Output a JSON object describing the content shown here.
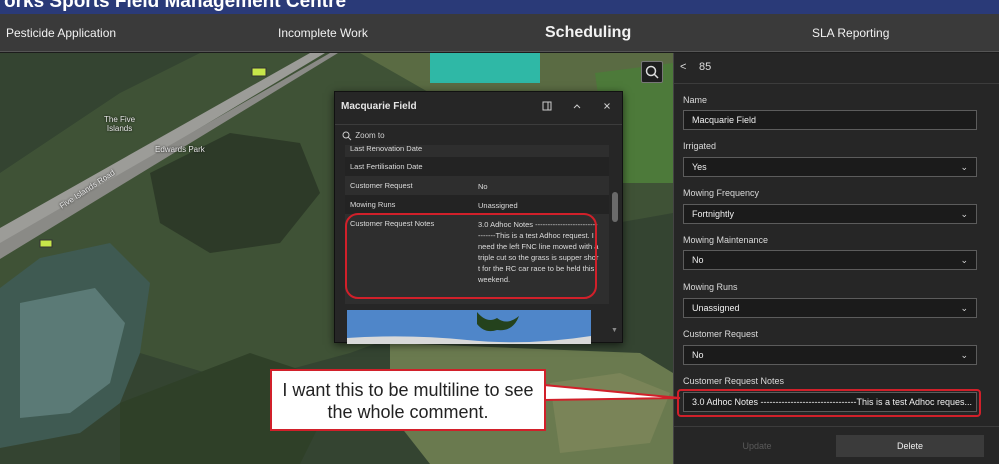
{
  "app": {
    "banner_title": "orks Sports Field Management Centre"
  },
  "nav": {
    "pesticide": "Pesticide Application",
    "incomplete": "Incomplete Work",
    "scheduling": "Scheduling",
    "sla": "SLA Reporting"
  },
  "map": {
    "labels": {
      "five_islands": "The Five\nIslands",
      "edwards_park": "Edwards Park",
      "road": "Five Islands Road"
    }
  },
  "popup": {
    "title": "Macquarie Field",
    "zoom_label": "Zoom to",
    "rows": [
      {
        "key": "Last Renovation Date",
        "value": ""
      },
      {
        "key": "Last Fertilisation Date",
        "value": ""
      },
      {
        "key": "Customer Request",
        "value": "No"
      },
      {
        "key": "Mowing Runs",
        "value": "Unassigned"
      },
      {
        "key": "Customer Request Notes",
        "value": "3.0 Adhoc Notes --------------------------------This is a test Adhoc request. I need the left FNC line mowed with a triple cut so the grass is supper short for the RC car race to be held this weekend."
      }
    ]
  },
  "panel": {
    "record_id": "85",
    "fields": [
      {
        "label": "Name",
        "value": "Macquarie Field",
        "type": "text"
      },
      {
        "label": "Irrigated",
        "value": "Yes",
        "type": "select"
      },
      {
        "label": "Mowing Frequency",
        "value": "Fortnightly",
        "type": "select"
      },
      {
        "label": "Mowing Maintenance",
        "value": "No",
        "type": "select"
      },
      {
        "label": "Mowing Runs",
        "value": "Unassigned",
        "type": "select"
      },
      {
        "label": "Customer Request",
        "value": "No",
        "type": "select"
      },
      {
        "label": "Customer Request Notes",
        "value": "3.0 Adhoc Notes --------------------------------This is a test Adhoc reques...",
        "type": "text"
      }
    ],
    "update_label": "Update",
    "delete_label": "Delete"
  },
  "callout": {
    "text": "I want this to be multiline to see the whole comment."
  },
  "colors": {
    "highlight": "#d1202a",
    "water": "#2fb8a6",
    "nav_bg": "#3a3a3a",
    "banner_bg": "#2a3a78"
  }
}
